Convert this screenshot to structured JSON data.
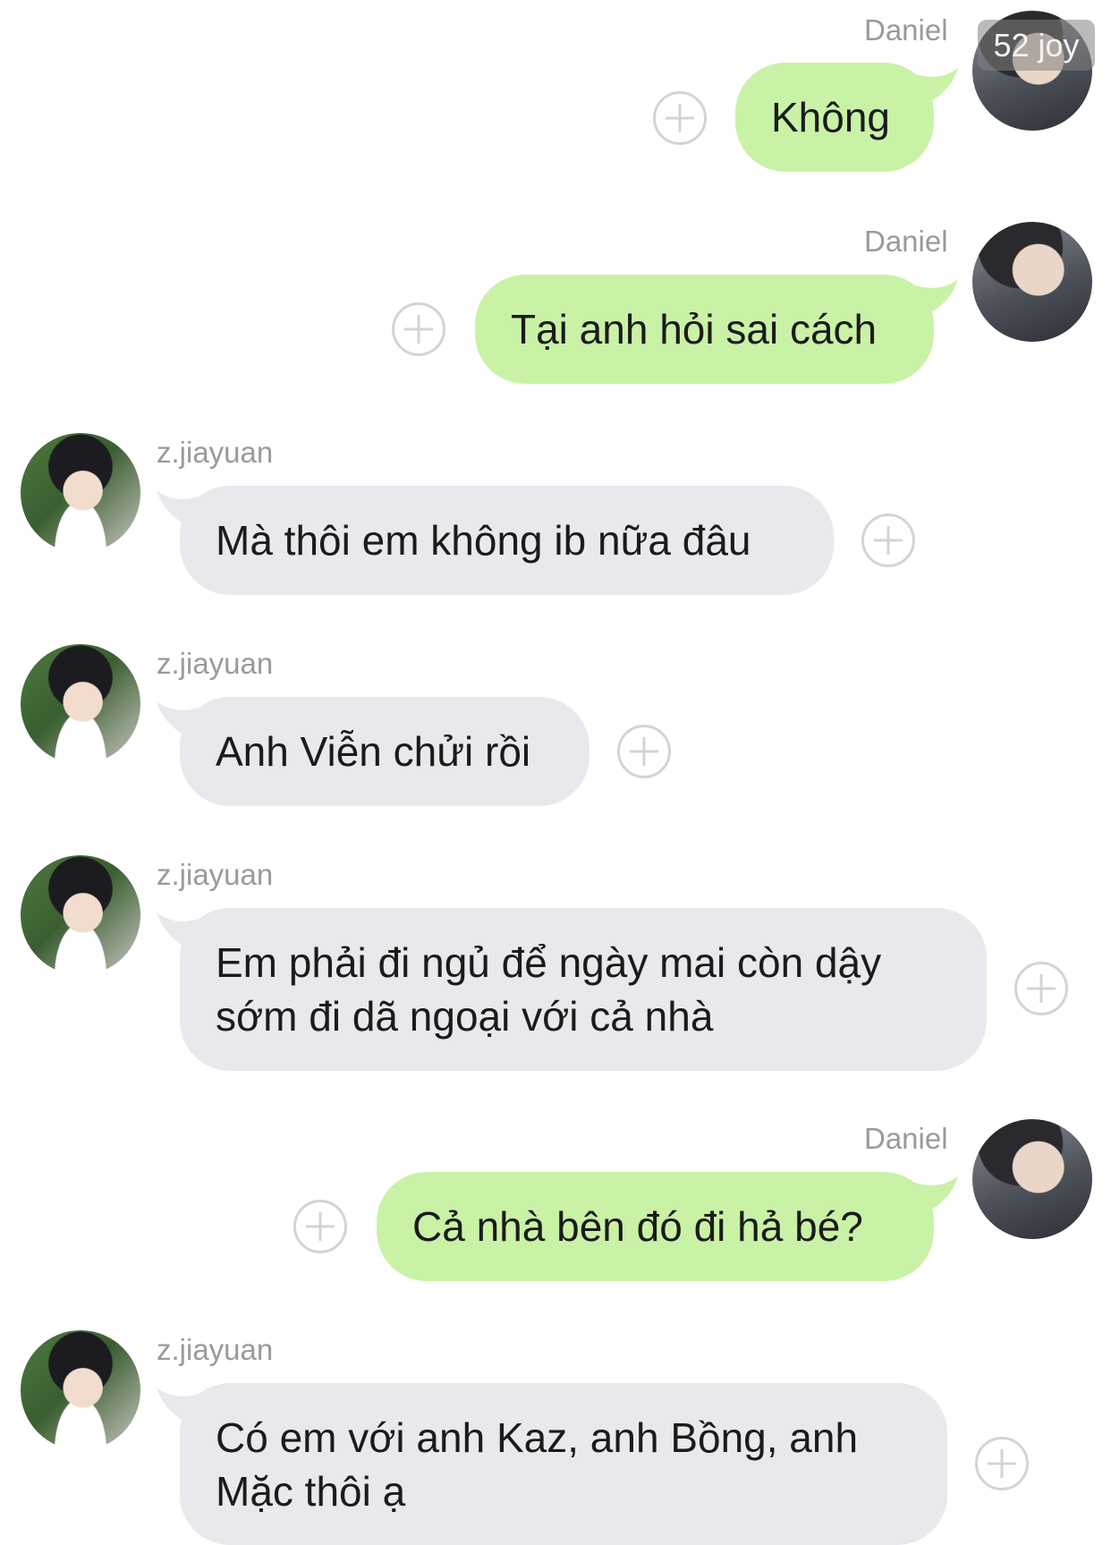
{
  "overlay": {
    "badge_text": "52 joy"
  },
  "colors": {
    "outgoing_bubble": "#c9f2a6",
    "incoming_bubble": "#e8e9ec",
    "sender_name": "#9a9a9a"
  },
  "messages": [
    {
      "sender": "Daniel",
      "text": "Không",
      "direction": "outgoing"
    },
    {
      "sender": "Daniel",
      "text": "Tại anh hỏi sai cách",
      "direction": "outgoing"
    },
    {
      "sender": "z.jiayuan",
      "text": "Mà thôi em không ib nữa đâu",
      "direction": "incoming"
    },
    {
      "sender": "z.jiayuan",
      "text": "Anh Viễn chửi rồi",
      "direction": "incoming"
    },
    {
      "sender": "z.jiayuan",
      "text": "Em phải đi ngủ để ngày mai còn dậy sớm đi dã ngoại với cả nhà",
      "direction": "incoming"
    },
    {
      "sender": "Daniel",
      "text": "Cả nhà bên đó đi hả bé?",
      "direction": "outgoing"
    },
    {
      "sender": "z.jiayuan",
      "text": "Có em với anh Kaz, anh Bồng, anh Mặc thôi ạ",
      "direction": "incoming"
    }
  ]
}
